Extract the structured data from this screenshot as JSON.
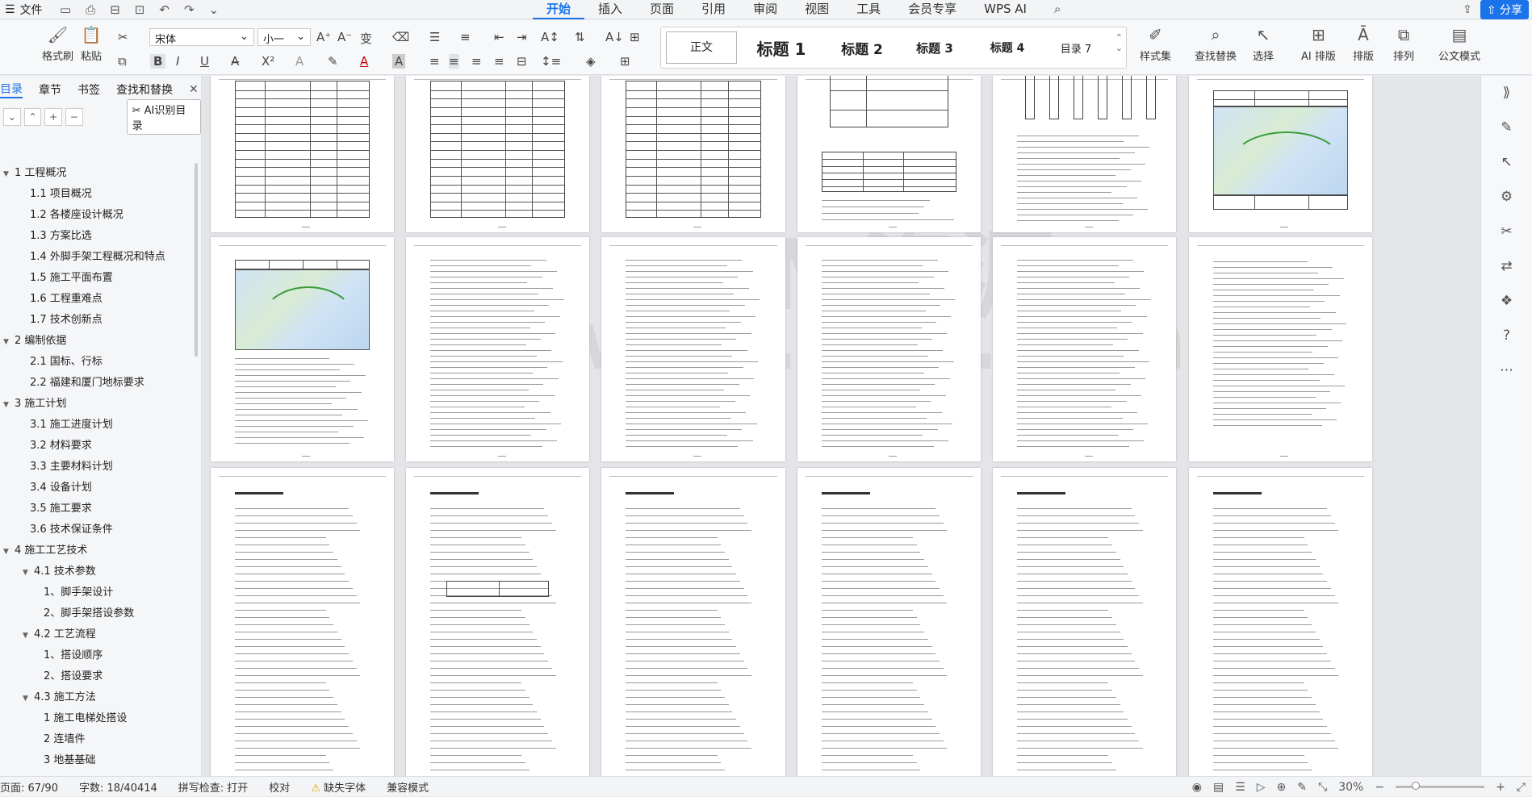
{
  "menubar": {
    "file_label": "文件",
    "tabs": [
      "开始",
      "插入",
      "页面",
      "引用",
      "审阅",
      "视图",
      "工具",
      "会员专享",
      "WPS AI"
    ],
    "active_tab": "开始",
    "share_label": "分享"
  },
  "ribbon": {
    "format_painter": "格式刷",
    "paste": "粘贴",
    "font_name": "宋体",
    "font_size": "小一",
    "styles": {
      "normal": "正文",
      "h1": "标题 1",
      "h2": "标题 2",
      "h3": "标题 3",
      "h4": "标题 4",
      "toc": "目录 7"
    },
    "style_set": "样式集",
    "find_replace": "查找替换",
    "select": "选择",
    "ai_layout": "AI 排版",
    "layout": "排版",
    "arrange": "排列",
    "official_mode": "公文模式"
  },
  "nav": {
    "tabs": [
      "目录",
      "章节",
      "书签",
      "查找和替换"
    ],
    "active_tab": "目录",
    "ai_toc_button": "AI识别目录",
    "toc": [
      {
        "level": 1,
        "text": "1  工程概况",
        "arrow": "▼"
      },
      {
        "level": 2,
        "text": "1.1 项目概况"
      },
      {
        "level": 2,
        "text": "1.2 各楼座设计概况"
      },
      {
        "level": 2,
        "text": "1.3 方案比选"
      },
      {
        "level": 2,
        "text": "1.4 外脚手架工程概况和特点"
      },
      {
        "level": 2,
        "text": "1.5 施工平面布置"
      },
      {
        "level": 2,
        "text": "1.6  工程重难点"
      },
      {
        "level": 2,
        "text": "1.7  技术创新点"
      },
      {
        "level": 1,
        "text": "2  编制依据",
        "arrow": "▼"
      },
      {
        "level": 2,
        "text": "2.1 国标、行标"
      },
      {
        "level": 2,
        "text": "2.2 福建和厦门地标要求"
      },
      {
        "level": 1,
        "text": "3  施工计划",
        "arrow": "▼"
      },
      {
        "level": 2,
        "text": "3.1 施工进度计划"
      },
      {
        "level": 2,
        "text": "3.2 材料要求"
      },
      {
        "level": 2,
        "text": "3.3 主要材料计划"
      },
      {
        "level": 2,
        "text": "3.4 设备计划"
      },
      {
        "level": 2,
        "text": "3.5 施工要求"
      },
      {
        "level": 2,
        "text": "3.6 技术保证条件"
      },
      {
        "level": 1,
        "text": "4  施工工艺技术",
        "arrow": "▼"
      },
      {
        "level": "2p",
        "text": "4.1 技术参数",
        "arrow": "▼"
      },
      {
        "level": 3,
        "text": "1、脚手架设计"
      },
      {
        "level": 3,
        "text": "2、脚手架搭设参数"
      },
      {
        "level": "2p",
        "text": "4.2 工艺流程",
        "arrow": "▼"
      },
      {
        "level": 3,
        "text": "1、搭设顺序"
      },
      {
        "level": 3,
        "text": "2、搭设要求"
      },
      {
        "level": "2p",
        "text": "4.3 施工方法",
        "arrow": "▼"
      },
      {
        "level": 3,
        "text": "1  施工电梯处搭设"
      },
      {
        "level": 3,
        "text": "2  连墙件"
      },
      {
        "level": 3,
        "text": "3  地基基础"
      }
    ]
  },
  "document": {
    "watermark_line1": "BIM资源",
    "watermark_line2": "www.bim.com"
  },
  "statusbar": {
    "page": "页面: 67/90",
    "words": "字数: 18/40414",
    "spellcheck": "拼写检查: 打开",
    "proof": "校对",
    "missing_font": "缺失字体",
    "compat": "兼容模式",
    "zoom": "30%"
  }
}
